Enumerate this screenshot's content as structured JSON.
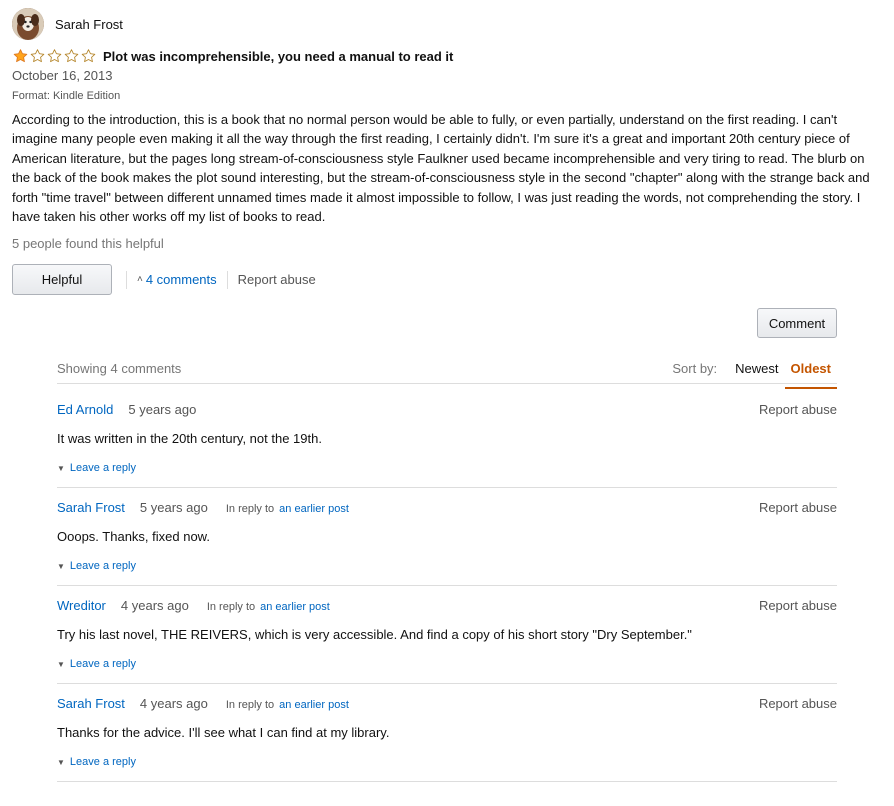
{
  "review": {
    "author": "Sarah Frost",
    "rating": 1,
    "max_rating": 5,
    "title": "Plot was incomprehensible, you need a manual to read it",
    "date": "October 16, 2013",
    "format": "Format: Kindle Edition",
    "body": "According to the introduction, this is a book that no normal person would be able to fully, or even partially, understand on the first reading. I can't imagine many people even making it all the way through the first reading, I certainly didn't. I'm sure it's a great and important 20th century piece of American literature, but the pages long stream-of-consciousness style Faulkner used became incomprehensible and very tiring to read. The blurb on the back of the book makes the plot sound interesting, but the stream-of-consciousness style in the second \"chapter\" along with the strange back and forth \"time travel\" between different unnamed times made it almost impossible to follow, I was just reading the words, not comprehending the story. I have taken his other works off my list of books to read.",
    "helpful_count": "5 people found this helpful",
    "helpful_button": "Helpful",
    "comments_link": "4 comments",
    "report_abuse": "Report abuse",
    "comment_button": "Comment"
  },
  "comments_section": {
    "showing": "Showing 4 comments",
    "sort_label": "Sort by:",
    "sort_newest": "Newest",
    "sort_oldest": "Oldest",
    "items": [
      {
        "author": "Ed Arnold",
        "age": "5 years ago",
        "in_reply_to": "",
        "earlier_post": "",
        "text": "It was written in the 20th century, not the 19th.",
        "reply": "Leave a reply",
        "report": "Report abuse"
      },
      {
        "author": "Sarah Frost",
        "age": "5 years ago",
        "in_reply_to": "In reply to",
        "earlier_post": "an earlier post",
        "text": "Ooops. Thanks, fixed now.",
        "reply": "Leave a reply",
        "report": "Report abuse"
      },
      {
        "author": "Wreditor",
        "age": "4 years ago",
        "in_reply_to": "In reply to",
        "earlier_post": "an earlier post",
        "text": "Try his last novel, THE REIVERS, which is very accessible. And find a copy of his short story \"Dry September.\"",
        "reply": "Leave a reply",
        "report": "Report abuse"
      },
      {
        "author": "Sarah Frost",
        "age": "4 years ago",
        "in_reply_to": "In reply to",
        "earlier_post": "an earlier post",
        "text": "Thanks for the advice. I'll see what I can find at my library.",
        "reply": "Leave a reply",
        "report": "Report abuse"
      }
    ]
  },
  "colors": {
    "link": "#0066c0",
    "star_fill": "#ffa41c",
    "sort_active": "#c45500"
  }
}
